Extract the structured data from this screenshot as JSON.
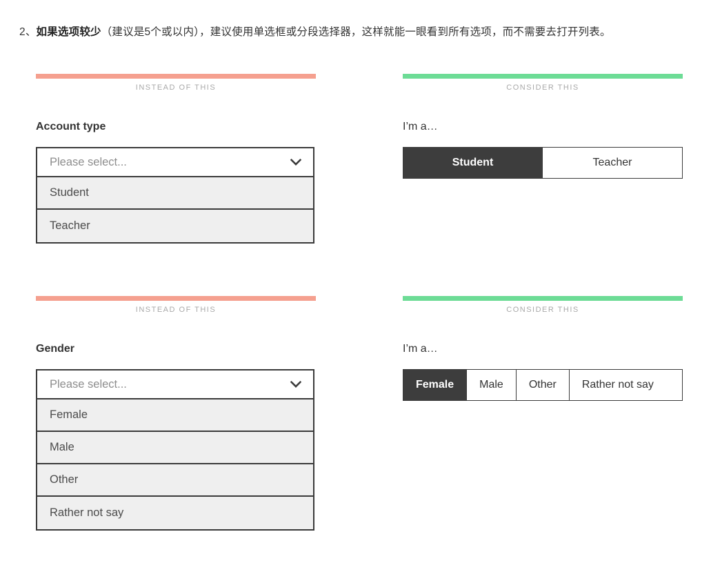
{
  "intro": {
    "number": "2、",
    "bold_phrase": "如果选项较少",
    "rest": "（建议是5个或以内），建议使用单选框或分段选择器，这样就能一眼看到所有选项，而不需要去打开列表。"
  },
  "banners": {
    "bad": "INSTEAD OF THIS",
    "good": "CONSIDER THIS",
    "bad_color": "#f5a08f",
    "good_color": "#6ddc96"
  },
  "examples": [
    {
      "bad": {
        "banner": "INSTEAD OF THIS",
        "field_label": "Account type",
        "placeholder": "Please select...",
        "chevron_icon": "chevron-down-icon",
        "options": [
          "Student",
          "Teacher"
        ]
      },
      "good": {
        "banner": "CONSIDER THIS",
        "field_label": "I’m a…",
        "segments": [
          {
            "label": "Student",
            "selected": true
          },
          {
            "label": "Teacher",
            "selected": false
          }
        ]
      }
    },
    {
      "bad": {
        "banner": "INSTEAD OF THIS",
        "field_label": "Gender",
        "placeholder": "Please select...",
        "chevron_icon": "chevron-down-icon",
        "options": [
          "Female",
          "Male",
          "Other",
          "Rather not say"
        ]
      },
      "good": {
        "banner": "CONSIDER THIS",
        "field_label": "I’m a…",
        "segments": [
          {
            "label": "Female",
            "selected": true
          },
          {
            "label": "Male",
            "selected": false
          },
          {
            "label": "Other",
            "selected": false
          },
          {
            "label": "Rather not say",
            "selected": false
          }
        ]
      }
    }
  ]
}
